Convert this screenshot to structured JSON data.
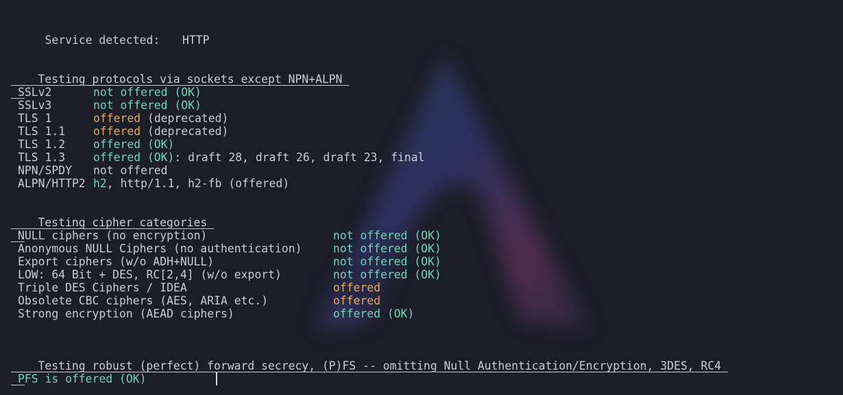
{
  "service": {
    "label": "Service detected:",
    "value": "HTTP"
  },
  "protocols": {
    "header": "Testing protocols via sockets except NPN+ALPN",
    "rows": [
      {
        "name": "SSLv2",
        "status": "not offered (OK)",
        "rest": ""
      },
      {
        "name": "SSLv3",
        "status": "not offered (OK)",
        "rest": ""
      },
      {
        "name": "TLS 1",
        "status": "offered",
        "rest": " (deprecated)"
      },
      {
        "name": "TLS 1.1",
        "status": "offered",
        "rest": " (deprecated)"
      },
      {
        "name": "TLS 1.2",
        "status": "offered (OK)",
        "rest": ""
      },
      {
        "name": "TLS 1.3",
        "status": "offered (OK)",
        "rest": ": draft 28, draft 26, draft 23, final"
      },
      {
        "name": "NPN/SPDY",
        "status": "",
        "rest": "not offered"
      },
      {
        "name": "ALPN/HTTP2",
        "status": "h2",
        "rest": ", http/1.1, h2-fb (offered)"
      }
    ]
  },
  "ciphers": {
    "header": "Testing cipher categories",
    "rows": [
      {
        "name": "NULL ciphers (no encryption)",
        "status": "not offered (OK)"
      },
      {
        "name": "Anonymous NULL Ciphers (no authentication)",
        "status": "not offered (OK)"
      },
      {
        "name": "Export ciphers (w/o ADH+NULL)",
        "status": "not offered (OK)"
      },
      {
        "name": "LOW: 64 Bit + DES, RC[2,4] (w/o export)",
        "status": "not offered (OK)"
      },
      {
        "name": "Triple DES Ciphers / IDEA",
        "status": "offered"
      },
      {
        "name": "Obsolete CBC ciphers (AES, ARIA etc.)",
        "status": "offered"
      },
      {
        "name": "Strong encryption (AEAD ciphers)",
        "status": "offered (OK)"
      }
    ]
  },
  "pfs": {
    "header": "Testing robust (perfect) forward secrecy, (P)FS -- omitting Null Authentication/Encryption, 3DES, RC4",
    "result": "PFS is offered (OK)"
  },
  "colors": {
    "background": "#1b1d27",
    "text": "#c9ccd6",
    "ok": "#6fd5b5",
    "warn": "#e8a95a"
  }
}
